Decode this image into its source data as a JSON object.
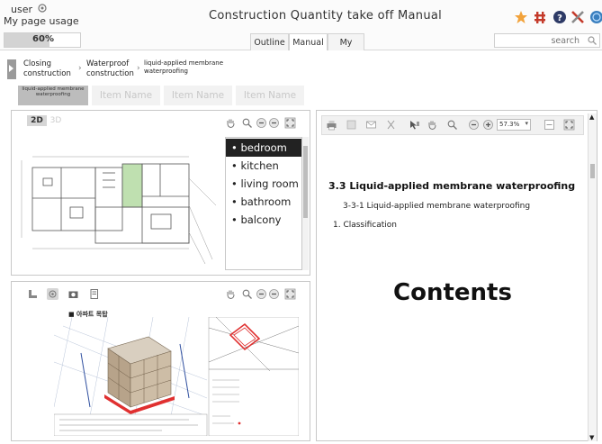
{
  "user": {
    "name": "user",
    "my_page_label": "My page usage",
    "usage_percent": 60,
    "usage_text": "60%"
  },
  "app": {
    "title": "Construction Quantity take off Manual"
  },
  "tabs": [
    {
      "label": "Outline",
      "active": false
    },
    {
      "label": "Manual",
      "active": true
    },
    {
      "label": "My",
      "active": false
    }
  ],
  "search": {
    "placeholder": "search"
  },
  "toolbar_icons": [
    "star-icon",
    "move-icon",
    "help-icon",
    "tools-icon",
    "globe-icon"
  ],
  "breadcrumb": [
    {
      "line1": "Closing",
      "line2": "construction"
    },
    {
      "line1": "Waterproof",
      "line2": "construction"
    },
    {
      "line1": "liquid-applied membrane",
      "line2": "waterproofing"
    }
  ],
  "item_tabs": [
    {
      "label": "liquid-applied membrane waterproofing",
      "active": true
    },
    {
      "label": "Item Name",
      "active": false
    },
    {
      "label": "Item Name",
      "active": false
    },
    {
      "label": "Item Name",
      "active": false
    }
  ],
  "plan_view": {
    "modes": [
      {
        "label": "2D",
        "active": true
      },
      {
        "label": "3D",
        "active": false
      }
    ],
    "rooms": [
      {
        "label": "• bedroom",
        "selected": true
      },
      {
        "label": "• kitchen",
        "selected": false
      },
      {
        "label": "• living room",
        "selected": false
      },
      {
        "label": "• bathroom",
        "selected": false
      },
      {
        "label": "• balcony",
        "selected": false
      }
    ]
  },
  "model_view": {
    "caption": "■ 아파트 목탑"
  },
  "document": {
    "zoom": "57.3%",
    "heading": "3.3 Liquid-applied membrane waterproofing",
    "subheading": "3-3-1 Liquid-applied membrane waterproofing",
    "item": "1. Classification",
    "placeholder": "Contents"
  },
  "colors": {
    "selected_room_bg": "#222222",
    "plan_highlight": "#bfe0b0",
    "model_highlight": "#e03030"
  }
}
